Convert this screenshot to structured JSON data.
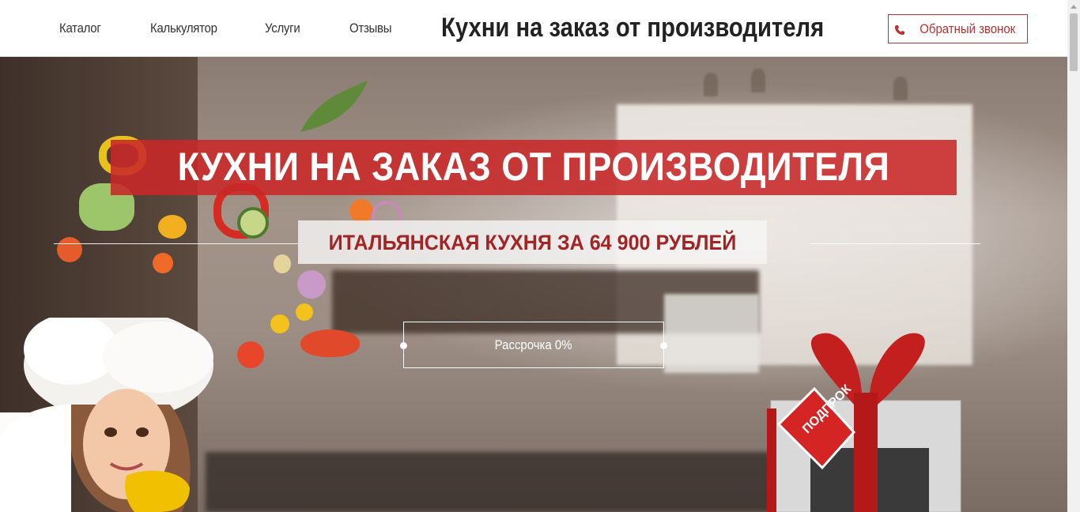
{
  "header": {
    "nav": [
      "Каталог",
      "Калькулятор",
      "Услуги",
      "Отзывы"
    ],
    "site_title": "Кухни на заказ от производителя",
    "callback_label": "Обратный звонок"
  },
  "hero": {
    "title": "КУХНИ НА ЗАКАЗ ОТ ПРОИЗВОДИТЕЛЯ",
    "subtitle": "ИТАЛЬЯНСКАЯ КУХНЯ ЗА 64 900 РУБЛЕЙ",
    "installment_label": "Рассрочка 0%",
    "gift_tag": "ПОДПРОК"
  },
  "colors": {
    "accent": "#b83232",
    "title_band": "#c82828",
    "subtitle_text": "#a22424"
  },
  "icons": {
    "callback": "phone-icon"
  }
}
